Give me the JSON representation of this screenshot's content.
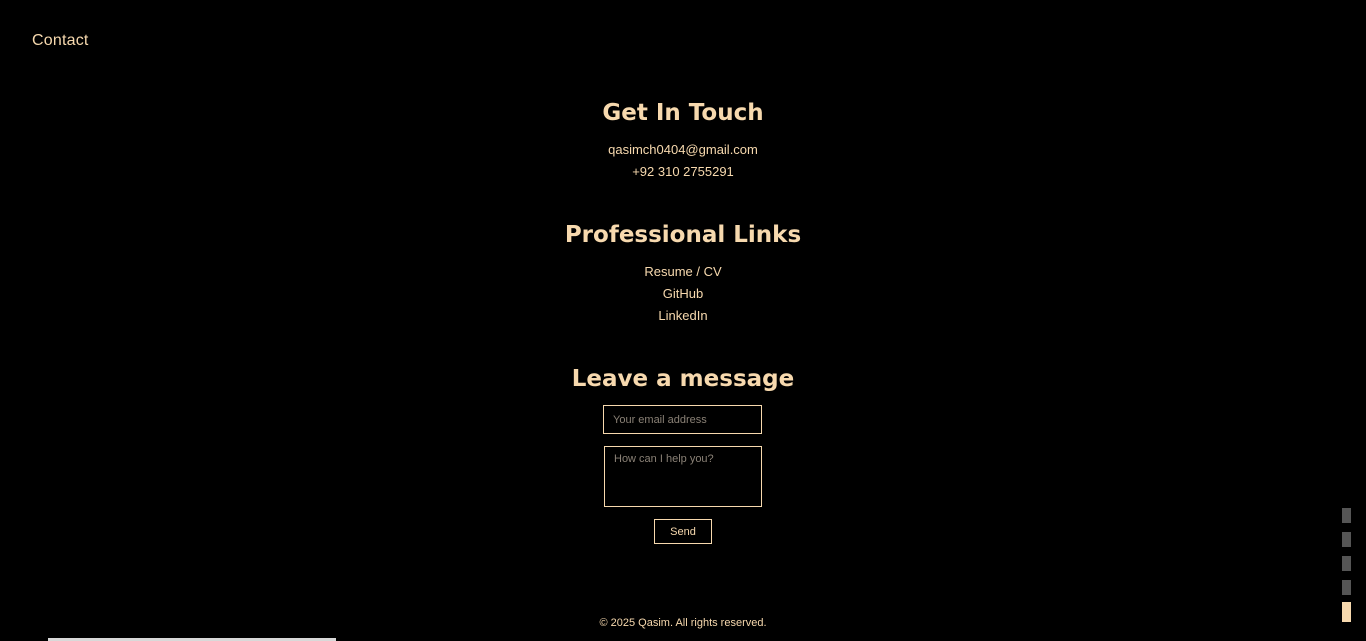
{
  "nav": {
    "title": "Contact"
  },
  "contact": {
    "heading": "Get In Touch",
    "email": "qasimch0404@gmail.com",
    "phone": "+92 310 2755291"
  },
  "links": {
    "heading": "Professional Links",
    "items": [
      {
        "label": "Resume / CV"
      },
      {
        "label": "GitHub"
      },
      {
        "label": "LinkedIn"
      }
    ]
  },
  "message": {
    "heading": "Leave a message",
    "email_placeholder": "Your email address",
    "message_placeholder": "How can I help you?",
    "send_label": "Send"
  },
  "footer": {
    "text": "© 2025 Qasim. All rights reserved."
  },
  "section_indicator": {
    "count": 5,
    "active_index": 4
  },
  "colors": {
    "background": "#000000",
    "accent": "#f7d9ae",
    "placeholder": "#8a8176",
    "indicator_inactive": "#555555"
  }
}
